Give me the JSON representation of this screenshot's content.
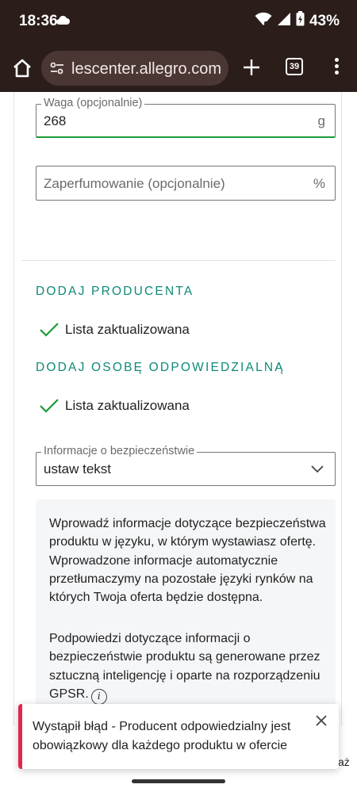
{
  "status_bar": {
    "time": "18:36",
    "battery": "43%"
  },
  "browser": {
    "url": "lescenter.allegro.com",
    "tab_count": "39"
  },
  "form": {
    "weight": {
      "label": "Waga (opcjonalnie)",
      "value": "268",
      "unit": "g"
    },
    "perfume": {
      "placeholder": "Zaperfumowanie (opcjonalnie)",
      "unit": "%"
    },
    "producer_section": {
      "title": "DODAJ PRODUCENTA",
      "status": "Lista zaktualizowana"
    },
    "responsible_section": {
      "title": "DODAJ OSOBĘ ODPOWIEDZIALNĄ",
      "status": "Lista zaktualizowana"
    },
    "safety_info": {
      "label": "Informacje o bezpieczeństwie",
      "selected": "ustaw tekst"
    },
    "info_box": {
      "paragraph1": "Wprowadź informacje dotyczące bezpieczeństwa produktu w języku, w którym wystawiasz ofertę. Wprowadzone informacje automatycznie przetłumaczymy na pozostałe języki rynków na których Twoja oferta będzie dostępna.",
      "paragraph2": "Podpowiedzi dotyczące informacji o bezpieczeństwie produktu są generowane przez sztuczną inteligencję i oparte na rozporządzeniu GPSR."
    },
    "cut_off_text": "aż"
  },
  "toast": {
    "message": "Wystąpił błąd - Producent odpowiedzialny jest obowiązkowy dla każdego produktu w ofercie"
  },
  "colors": {
    "accent_teal": "#0d8a78",
    "success_green": "#1a9b36",
    "error_red": "#e2264f",
    "browser_chrome": "#2a1d1a"
  }
}
